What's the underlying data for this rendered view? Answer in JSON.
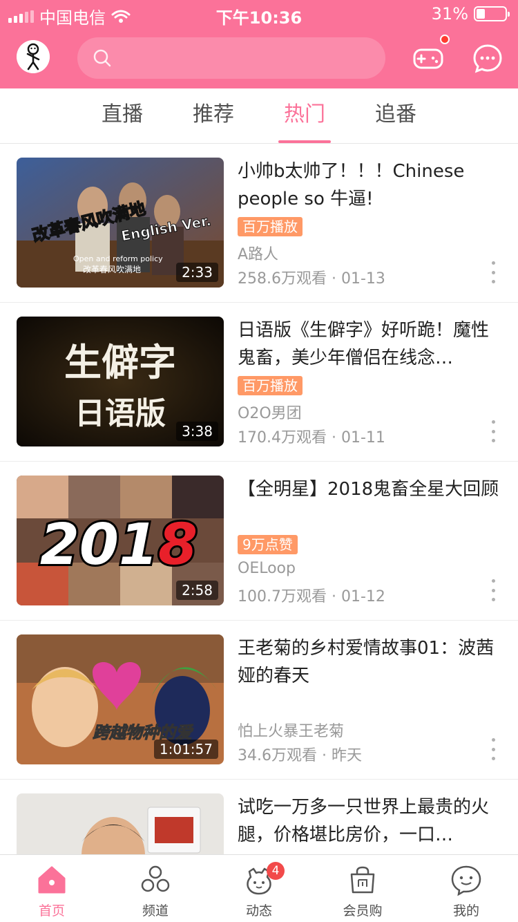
{
  "status_bar": {
    "carrier": "中国电信",
    "time": "下午10:36",
    "battery_text": "31%",
    "battery_level": 0.31
  },
  "header": {
    "search_placeholder": "",
    "game_center_has_dot": true
  },
  "tabs": [
    {
      "label": "直播",
      "active": false
    },
    {
      "label": "推荐",
      "active": false
    },
    {
      "label": "热门",
      "active": true
    },
    {
      "label": "追番",
      "active": false
    }
  ],
  "videos": [
    {
      "title": "小帅b太帅了！！！Chinese people so 牛逼!",
      "badge": "百万播放",
      "uploader": "A路人",
      "stats": "258.6万观看 · 01-13",
      "duration": "2:33",
      "thumb_text": [
        "改革春风吹满地",
        "English Ver.",
        "Open and reform policy",
        "改革春风吹满地"
      ]
    },
    {
      "title": "日语版《生僻字》好听跪！魔性鬼畜，美少年僧侣在线念…",
      "badge": "百万播放",
      "uploader": "O2O男团",
      "stats": "170.4万观看 · 01-11",
      "duration": "3:38",
      "thumb_text": [
        "生僻字",
        "日语版"
      ]
    },
    {
      "title": "【全明星】2018鬼畜全星大回顾",
      "badge": "9万点赞",
      "uploader": "OELoop",
      "stats": "100.7万观看 · 01-12",
      "duration": "2:58",
      "thumb_text": [
        "201",
        "8"
      ]
    },
    {
      "title": "王老菊的乡村爱情故事01：波茜娅的春天",
      "badge": "",
      "uploader": "怕上火暴王老菊",
      "stats": "34.6万观看 · 昨天",
      "duration": "1:01:57",
      "thumb_text": [
        "跨越物种的爱"
      ]
    },
    {
      "title": "试吃一万多一只世界上最贵的火腿，价格堪比房价，一口…",
      "badge": "",
      "uploader": "",
      "stats": "",
      "duration": "",
      "thumb_text": []
    }
  ],
  "bottom_nav": [
    {
      "label": "首页",
      "icon": "home-icon",
      "active": true
    },
    {
      "label": "频道",
      "icon": "channel-icon",
      "active": false
    },
    {
      "label": "动态",
      "icon": "dynamic-icon",
      "active": false,
      "count": "4"
    },
    {
      "label": "会员购",
      "icon": "shop-bag-icon",
      "active": false
    },
    {
      "label": "我的",
      "icon": "profile-icon",
      "active": false
    }
  ],
  "colors": {
    "brand": "#fb7299",
    "badge": "#ff9966",
    "notify": "#f24a4a"
  }
}
